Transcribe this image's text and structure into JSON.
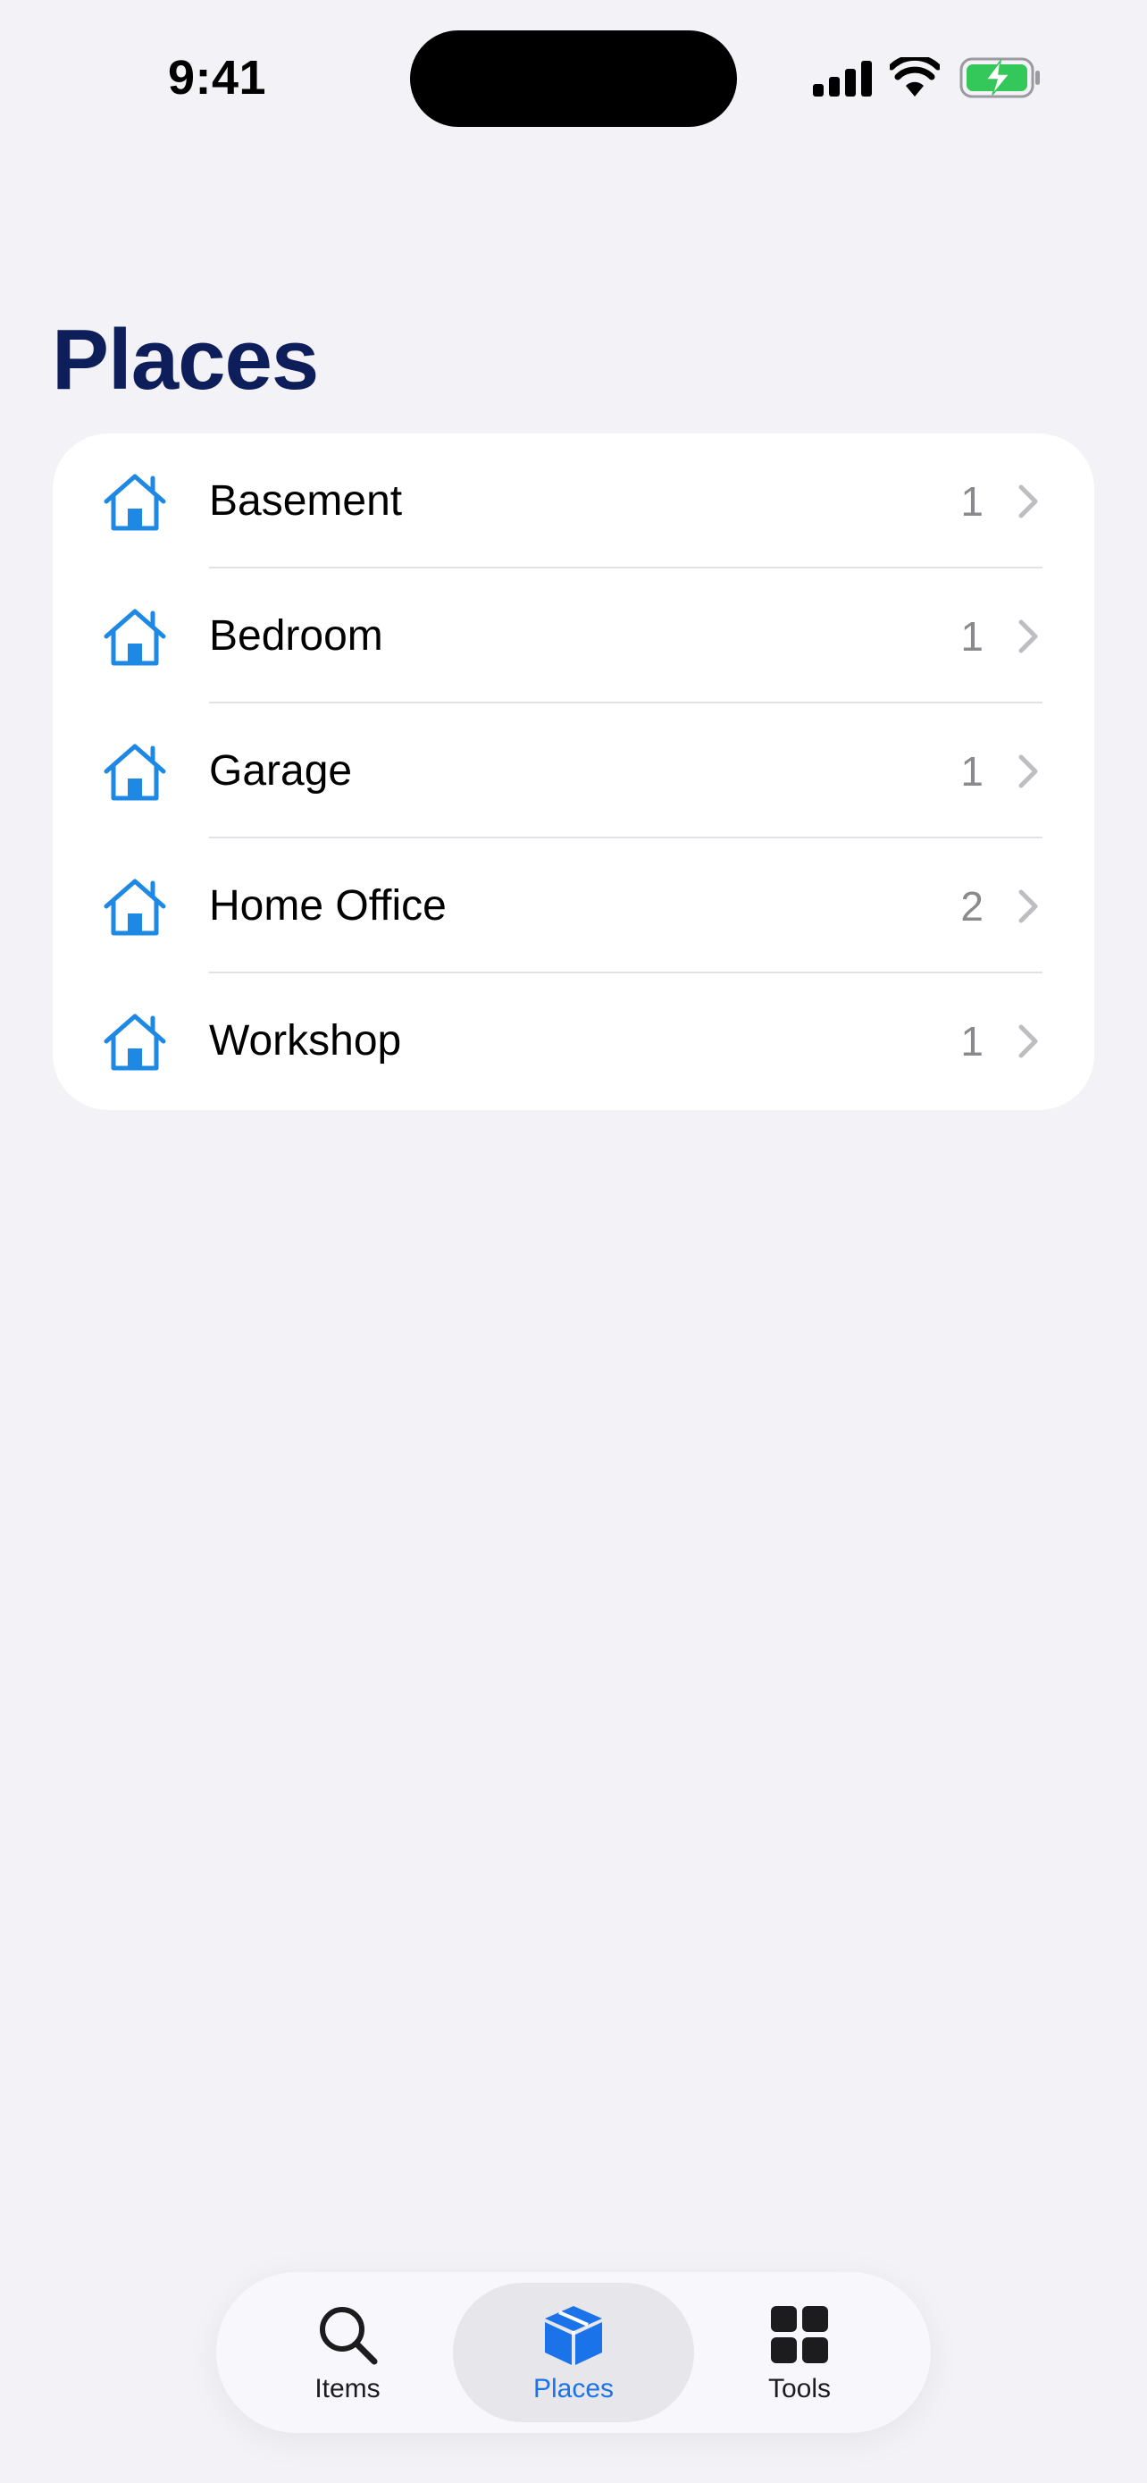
{
  "status_bar": {
    "time": "9:41"
  },
  "title": "Places",
  "places": [
    {
      "name": "Basement",
      "count": "1",
      "icon": "house-icon"
    },
    {
      "name": "Bedroom",
      "count": "1",
      "icon": "house-icon"
    },
    {
      "name": "Garage",
      "count": "1",
      "icon": "house-icon"
    },
    {
      "name": "Home Office",
      "count": "2",
      "icon": "house-icon"
    },
    {
      "name": "Workshop",
      "count": "1",
      "icon": "house-icon"
    }
  ],
  "tab_bar": {
    "tabs": [
      {
        "label": "Items",
        "icon": "magnifying-glass-icon",
        "active": false
      },
      {
        "label": "Places",
        "icon": "box-icon",
        "active": true
      },
      {
        "label": "Tools",
        "icon": "grid-icon",
        "active": false
      }
    ]
  },
  "colors": {
    "background": "#F2F2F7",
    "title": "#0E1E5B",
    "accent": "#1A73E8",
    "icon_blue": "#1E88E5",
    "battery_green": "#34C759"
  }
}
